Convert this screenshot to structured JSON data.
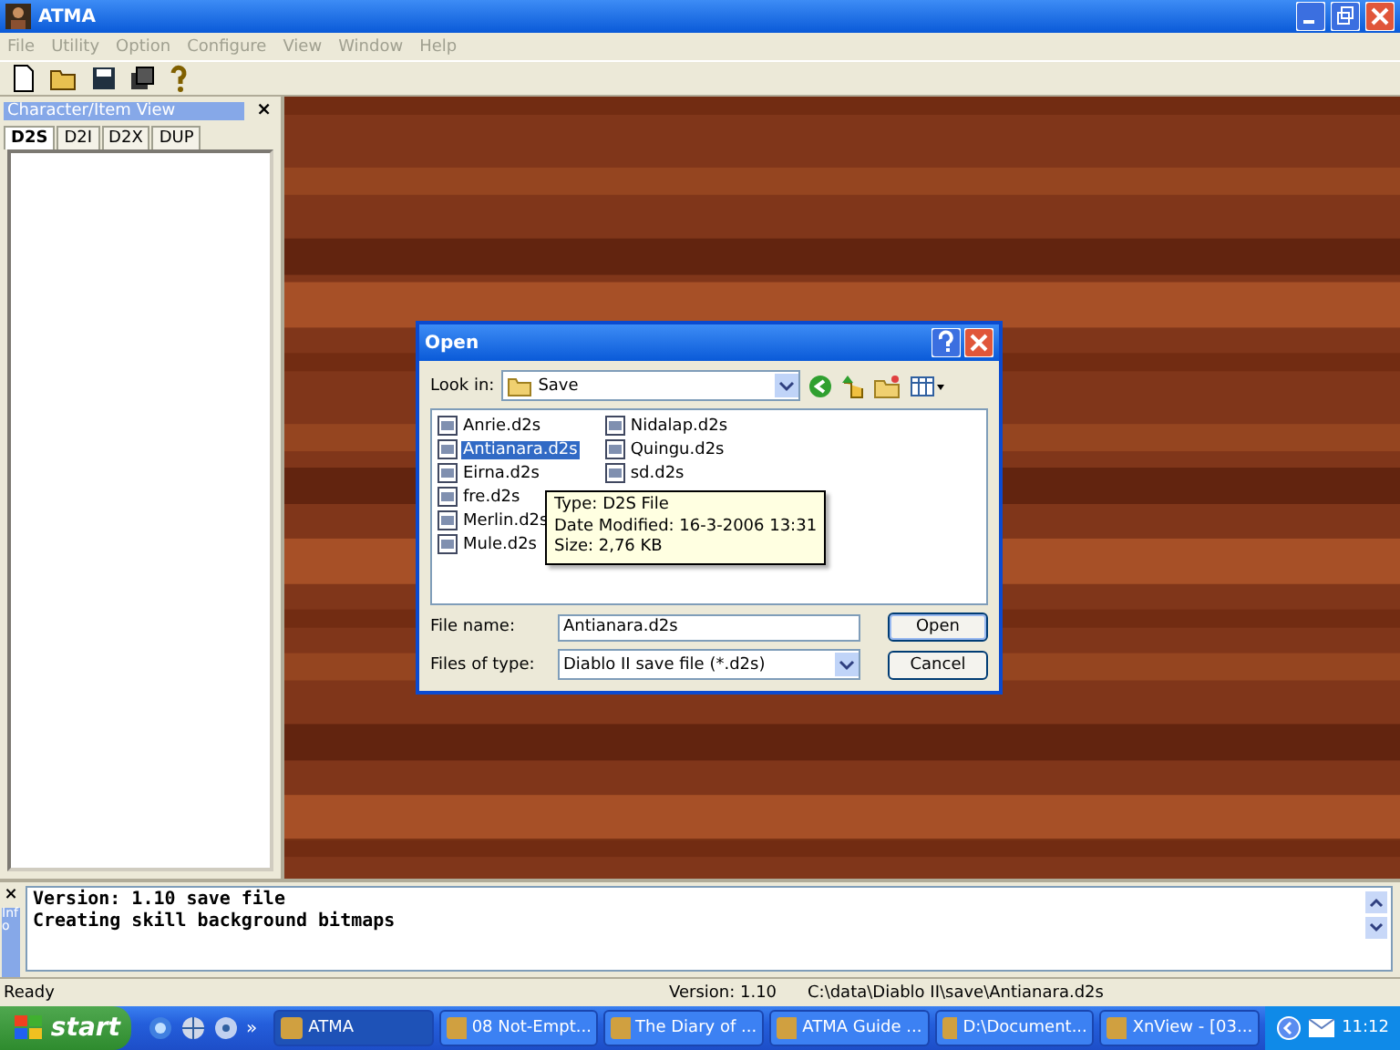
{
  "window": {
    "title": "ATMA"
  },
  "menu": [
    {
      "label": "File",
      "disabled": true
    },
    {
      "label": "Utility",
      "disabled": true
    },
    {
      "label": "Option",
      "disabled": true
    },
    {
      "label": "Configure",
      "disabled": true
    },
    {
      "label": "View",
      "disabled": true
    },
    {
      "label": "Window",
      "disabled": true
    },
    {
      "label": "Help",
      "disabled": true
    }
  ],
  "panel": {
    "title": "Character/Item View",
    "close": "×",
    "tabs": [
      {
        "label": "D2S",
        "selected": true
      },
      {
        "label": "D2I",
        "selected": false
      },
      {
        "label": "D2X",
        "selected": false
      },
      {
        "label": "DUP",
        "selected": false
      }
    ]
  },
  "dialog": {
    "title": "Open",
    "look_in_label": "Look in:",
    "look_in": "Save",
    "files": [
      {
        "name": "Anrie.d2s",
        "selected": false
      },
      {
        "name": "Antianara.d2s",
        "selected": true
      },
      {
        "name": "Eirna.d2s",
        "selected": false
      },
      {
        "name": "fre.d2s",
        "selected": false
      },
      {
        "name": "Merlin.d2s",
        "selected": false
      },
      {
        "name": "Mule.d2s",
        "selected": false
      },
      {
        "name": "Nidalap.d2s",
        "selected": false
      },
      {
        "name": "Quingu.d2s",
        "selected": false
      },
      {
        "name": "sd.d2s",
        "selected": false
      }
    ],
    "tooltip": [
      "Type: D2S File",
      "Date Modified: 16-3-2006 13:31",
      "Size: 2,76 KB"
    ],
    "file_name_label": "File name:",
    "file_name": "Antianara.d2s",
    "file_type_label": "Files of type:",
    "file_type": "Diablo II save file (*.d2s)",
    "buttons": [
      "Open",
      "Cancel"
    ]
  },
  "info": {
    "label": "Info",
    "close": "×",
    "lines": [
      "Version: 1.10 save file",
      "Creating skill background bitmaps"
    ]
  },
  "status_bar": {
    "ready": "Ready",
    "version": "Version: 1.10",
    "path": "C:\\data\\Diablo II\\save\\Antianara.d2s"
  },
  "taskbar": {
    "start": "start",
    "more": "»",
    "items": [
      {
        "label": "ATMA",
        "selected": true
      },
      {
        "label": "08 Not-Empt...",
        "selected": false
      },
      {
        "label": "The Diary of ...",
        "selected": false
      },
      {
        "label": "ATMA Guide ...",
        "selected": false
      },
      {
        "label": "D:\\Document...",
        "selected": false
      },
      {
        "label": "XnView - [03...",
        "selected": false
      }
    ],
    "clock": "11:12"
  }
}
